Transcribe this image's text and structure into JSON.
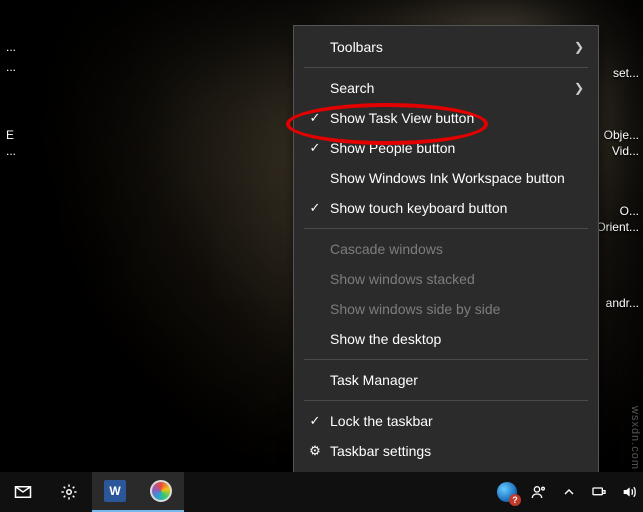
{
  "desktop_labels": {
    "l1": "...",
    "l2": "...",
    "l3": "E",
    "l4": "...",
    "r1": "set...",
    "r2": "Obje...",
    "r3": "Vid...",
    "r4": "O...",
    "r5": "Orient...",
    "r6": "andr..."
  },
  "menu": {
    "toolbars": "Toolbars",
    "search": "Search",
    "show_task_view": "Show Task View button",
    "show_people": "Show People button",
    "show_ink": "Show Windows Ink Workspace button",
    "show_touch_kb": "Show touch keyboard button",
    "cascade": "Cascade windows",
    "stacked": "Show windows stacked",
    "side_by_side": "Show windows side by side",
    "show_desktop": "Show the desktop",
    "task_manager": "Task Manager",
    "lock_taskbar": "Lock the taskbar",
    "taskbar_settings": "Taskbar settings"
  },
  "taskbar": {
    "word_letter": "W",
    "globe_badge": "?"
  },
  "watermark": "wsxdn.com"
}
